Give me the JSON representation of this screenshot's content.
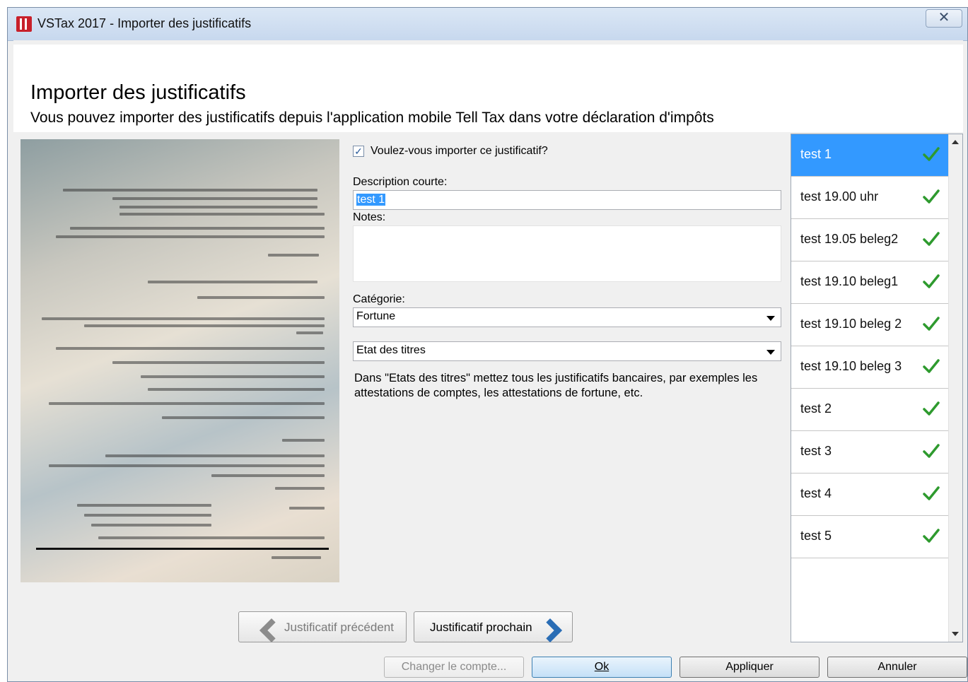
{
  "window": {
    "title": "VSTax 2017 - Importer des justificatifs",
    "close_glyph": "✕"
  },
  "header": {
    "title": "Importer des justificatifs",
    "subtitle": "Vous pouvez importer des justificatifs depuis l'application mobile Tell Tax dans votre déclaration d'impôts"
  },
  "form": {
    "import_checkbox": {
      "label": "Voulez-vous importer ce justificatif?",
      "checked": true
    },
    "description_label": "Description courte:",
    "description_value": "test 1",
    "notes_label": "Notes:",
    "notes_value": "",
    "category_label": "Catégorie:",
    "category_value": "Fortune",
    "subcategory_value": "Etat des titres",
    "help_text": "Dans \"Etats des titres\" mettez tous les justificatifs bancaires, par exemples les attestations de comptes, les attestations de fortune, etc."
  },
  "navigation": {
    "previous_label": "Justificatif précédent",
    "next_label": "Justificatif prochain"
  },
  "receipts": {
    "selected_index": 0,
    "check_color": "#2e9a2e",
    "items": [
      {
        "label": "test 1",
        "status": "check-icon"
      },
      {
        "label": "test 19.00 uhr",
        "status": "check-icon"
      },
      {
        "label": "test 19.05 beleg2",
        "status": "check-icon"
      },
      {
        "label": "test 19.10 beleg1",
        "status": "check-icon"
      },
      {
        "label": "test 19.10 beleg 2",
        "status": "check-icon"
      },
      {
        "label": "test 19.10 beleg 3",
        "status": "check-icon"
      },
      {
        "label": "test 2",
        "status": "check-icon"
      },
      {
        "label": "test 3",
        "status": "check-icon"
      },
      {
        "label": "test 4",
        "status": "check-icon"
      },
      {
        "label": "test 5",
        "status": "check-icon"
      }
    ]
  },
  "buttons": {
    "change_account": "Changer le compte...",
    "ok": "Ok",
    "apply": "Appliquer",
    "cancel": "Annuler"
  },
  "colors": {
    "accent": "#3399ff",
    "window_bg": "#f0f0f0",
    "chevron": "#2a6db5",
    "chevron_disabled": "#8c8c8c"
  }
}
